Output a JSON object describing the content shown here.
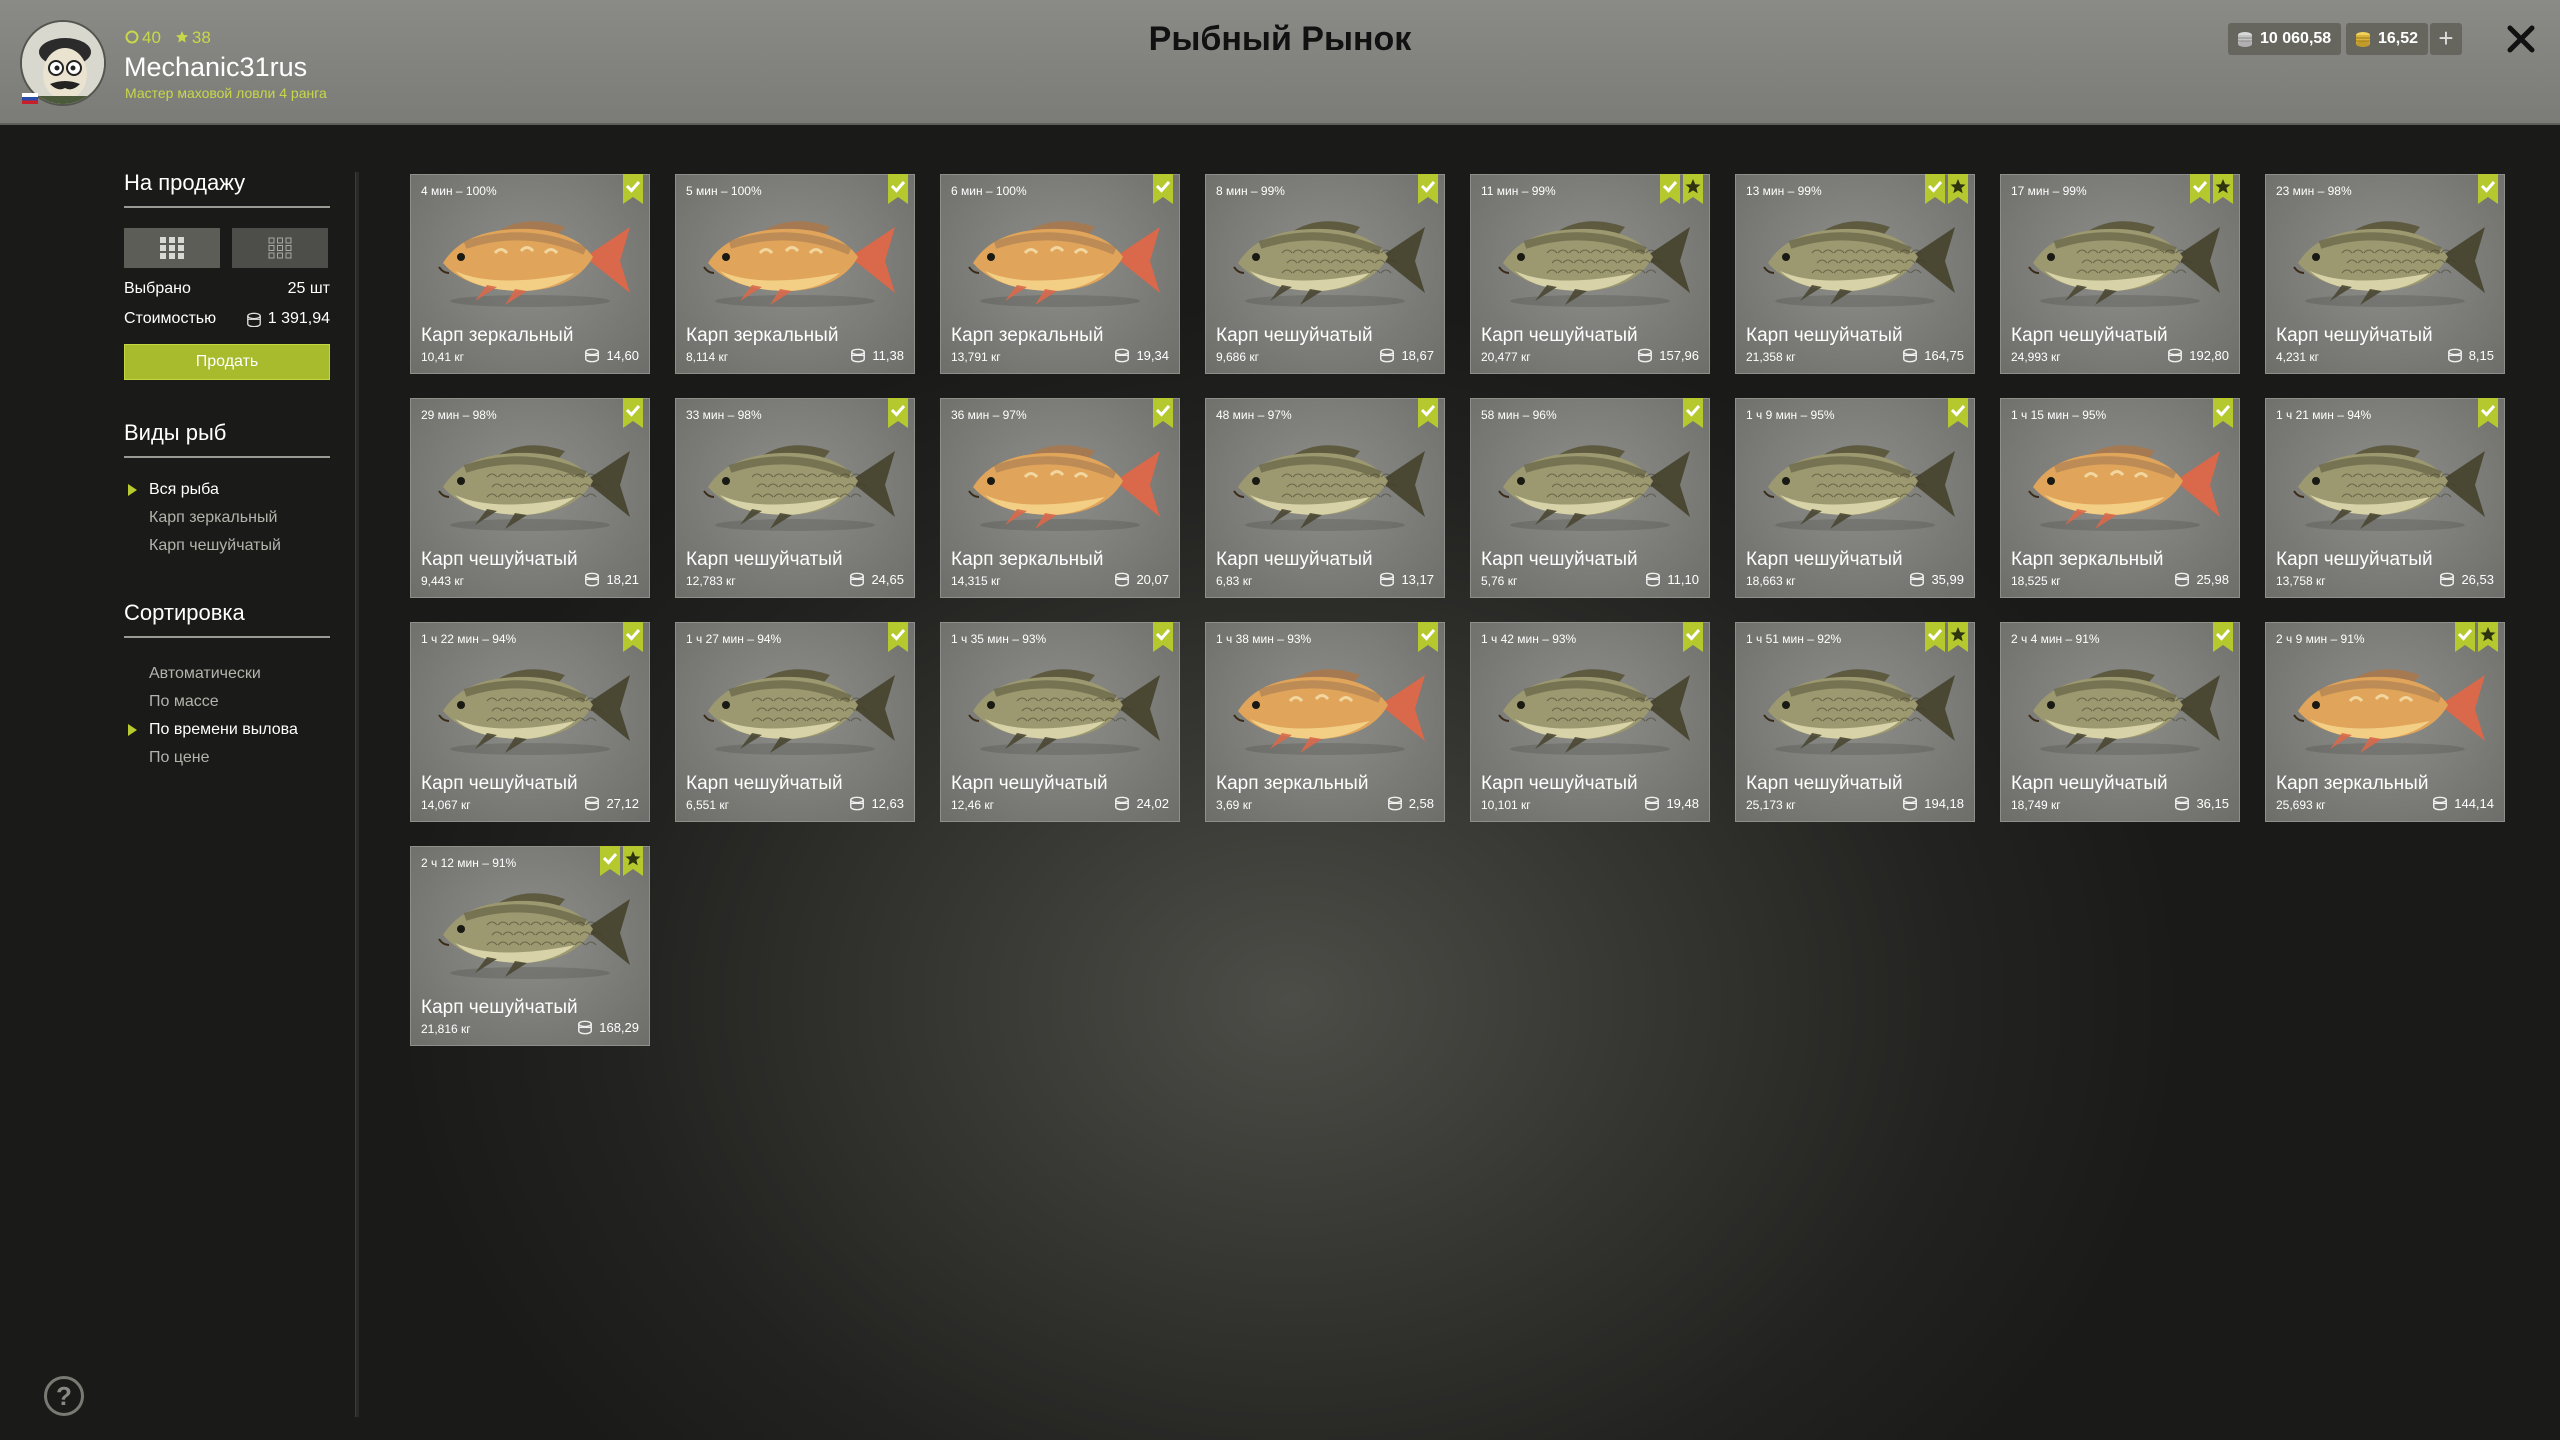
{
  "header": {
    "title": "Рыбный Рынок",
    "user": {
      "name": "Mechanic31rus",
      "rank": "Мастер маховой ловли 4 ранга",
      "level": "40",
      "stars": "38"
    },
    "silver": "10 060,58",
    "gold": "16,52",
    "add_label": "+"
  },
  "sidebar": {
    "for_sale_title": "На продажу",
    "selected_label": "Выбрано",
    "selected_value": "25 шт",
    "cost_label": "Стоимостью",
    "cost_value": "1 391,94",
    "sell_button": "Продать",
    "species_title": "Виды рыб",
    "species": [
      "Вся рыба",
      "Карп зеркальный",
      "Карп чешуйчатый"
    ],
    "species_active": 0,
    "sort_title": "Сортировка",
    "sort_options": [
      "Автоматически",
      "По массе",
      "По времени вылова",
      "По цене"
    ],
    "sort_active": 2
  },
  "colors": {
    "accent": "#a7bb2c",
    "badge": "#b5c92f"
  },
  "fish": [
    {
      "time": "4 мин – 100%",
      "name": "Карп зеркальный",
      "weight": "10,41 кг",
      "price": "14,60",
      "type": "mirror",
      "trophy": false
    },
    {
      "time": "5 мин – 100%",
      "name": "Карп зеркальный",
      "weight": "8,114 кг",
      "price": "11,38",
      "type": "mirror",
      "trophy": false
    },
    {
      "time": "6 мин – 100%",
      "name": "Карп зеркальный",
      "weight": "13,791 кг",
      "price": "19,34",
      "type": "mirror",
      "trophy": false
    },
    {
      "time": "8 мин – 99%",
      "name": "Карп чешуйчатый",
      "weight": "9,686 кг",
      "price": "18,67",
      "type": "common",
      "trophy": false
    },
    {
      "time": "11 мин – 99%",
      "name": "Карп чешуйчатый",
      "weight": "20,477 кг",
      "price": "157,96",
      "type": "common",
      "trophy": true
    },
    {
      "time": "13 мин – 99%",
      "name": "Карп чешуйчатый",
      "weight": "21,358 кг",
      "price": "164,75",
      "type": "common",
      "trophy": true
    },
    {
      "time": "17 мин – 99%",
      "name": "Карп чешуйчатый",
      "weight": "24,993 кг",
      "price": "192,80",
      "type": "common",
      "trophy": true
    },
    {
      "time": "23 мин – 98%",
      "name": "Карп чешуйчатый",
      "weight": "4,231 кг",
      "price": "8,15",
      "type": "common",
      "trophy": false
    },
    {
      "time": "29 мин – 98%",
      "name": "Карп чешуйчатый",
      "weight": "9,443 кг",
      "price": "18,21",
      "type": "common",
      "trophy": false
    },
    {
      "time": "33 мин – 98%",
      "name": "Карп чешуйчатый",
      "weight": "12,783 кг",
      "price": "24,65",
      "type": "common",
      "trophy": false
    },
    {
      "time": "36 мин – 97%",
      "name": "Карп зеркальный",
      "weight": "14,315 кг",
      "price": "20,07",
      "type": "mirror",
      "trophy": false
    },
    {
      "time": "48 мин – 97%",
      "name": "Карп чешуйчатый",
      "weight": "6,83 кг",
      "price": "13,17",
      "type": "common",
      "trophy": false
    },
    {
      "time": "58 мин – 96%",
      "name": "Карп чешуйчатый",
      "weight": "5,76 кг",
      "price": "11,10",
      "type": "common",
      "trophy": false
    },
    {
      "time": "1 ч 9 мин – 95%",
      "name": "Карп чешуйчатый",
      "weight": "18,663 кг",
      "price": "35,99",
      "type": "common",
      "trophy": false
    },
    {
      "time": "1 ч 15 мин – 95%",
      "name": "Карп зеркальный",
      "weight": "18,525 кг",
      "price": "25,98",
      "type": "mirror",
      "trophy": false
    },
    {
      "time": "1 ч 21 мин – 94%",
      "name": "Карп чешуйчатый",
      "weight": "13,758 кг",
      "price": "26,53",
      "type": "common",
      "trophy": false
    },
    {
      "time": "1 ч 22 мин – 94%",
      "name": "Карп чешуйчатый",
      "weight": "14,067 кг",
      "price": "27,12",
      "type": "common",
      "trophy": false
    },
    {
      "time": "1 ч 27 мин – 94%",
      "name": "Карп чешуйчатый",
      "weight": "6,551 кг",
      "price": "12,63",
      "type": "common",
      "trophy": false
    },
    {
      "time": "1 ч 35 мин – 93%",
      "name": "Карп чешуйчатый",
      "weight": "12,46 кг",
      "price": "24,02",
      "type": "common",
      "trophy": false
    },
    {
      "time": "1 ч 38 мин – 93%",
      "name": "Карп зеркальный",
      "weight": "3,69 кг",
      "price": "2,58",
      "type": "mirror",
      "trophy": false
    },
    {
      "time": "1 ч 42 мин – 93%",
      "name": "Карп чешуйчатый",
      "weight": "10,101 кг",
      "price": "19,48",
      "type": "common",
      "trophy": false
    },
    {
      "time": "1 ч 51 мин – 92%",
      "name": "Карп чешуйчатый",
      "weight": "25,173 кг",
      "price": "194,18",
      "type": "common",
      "trophy": true
    },
    {
      "time": "2 ч 4 мин – 91%",
      "name": "Карп чешуйчатый",
      "weight": "18,749 кг",
      "price": "36,15",
      "type": "common",
      "trophy": false
    },
    {
      "time": "2 ч 9 мин – 91%",
      "name": "Карп зеркальный",
      "weight": "25,693 кг",
      "price": "144,14",
      "type": "mirror",
      "trophy": true
    },
    {
      "time": "2 ч 12 мин – 91%",
      "name": "Карп чешуйчатый",
      "weight": "21,816 кг",
      "price": "168,29",
      "type": "common",
      "trophy": true
    }
  ]
}
